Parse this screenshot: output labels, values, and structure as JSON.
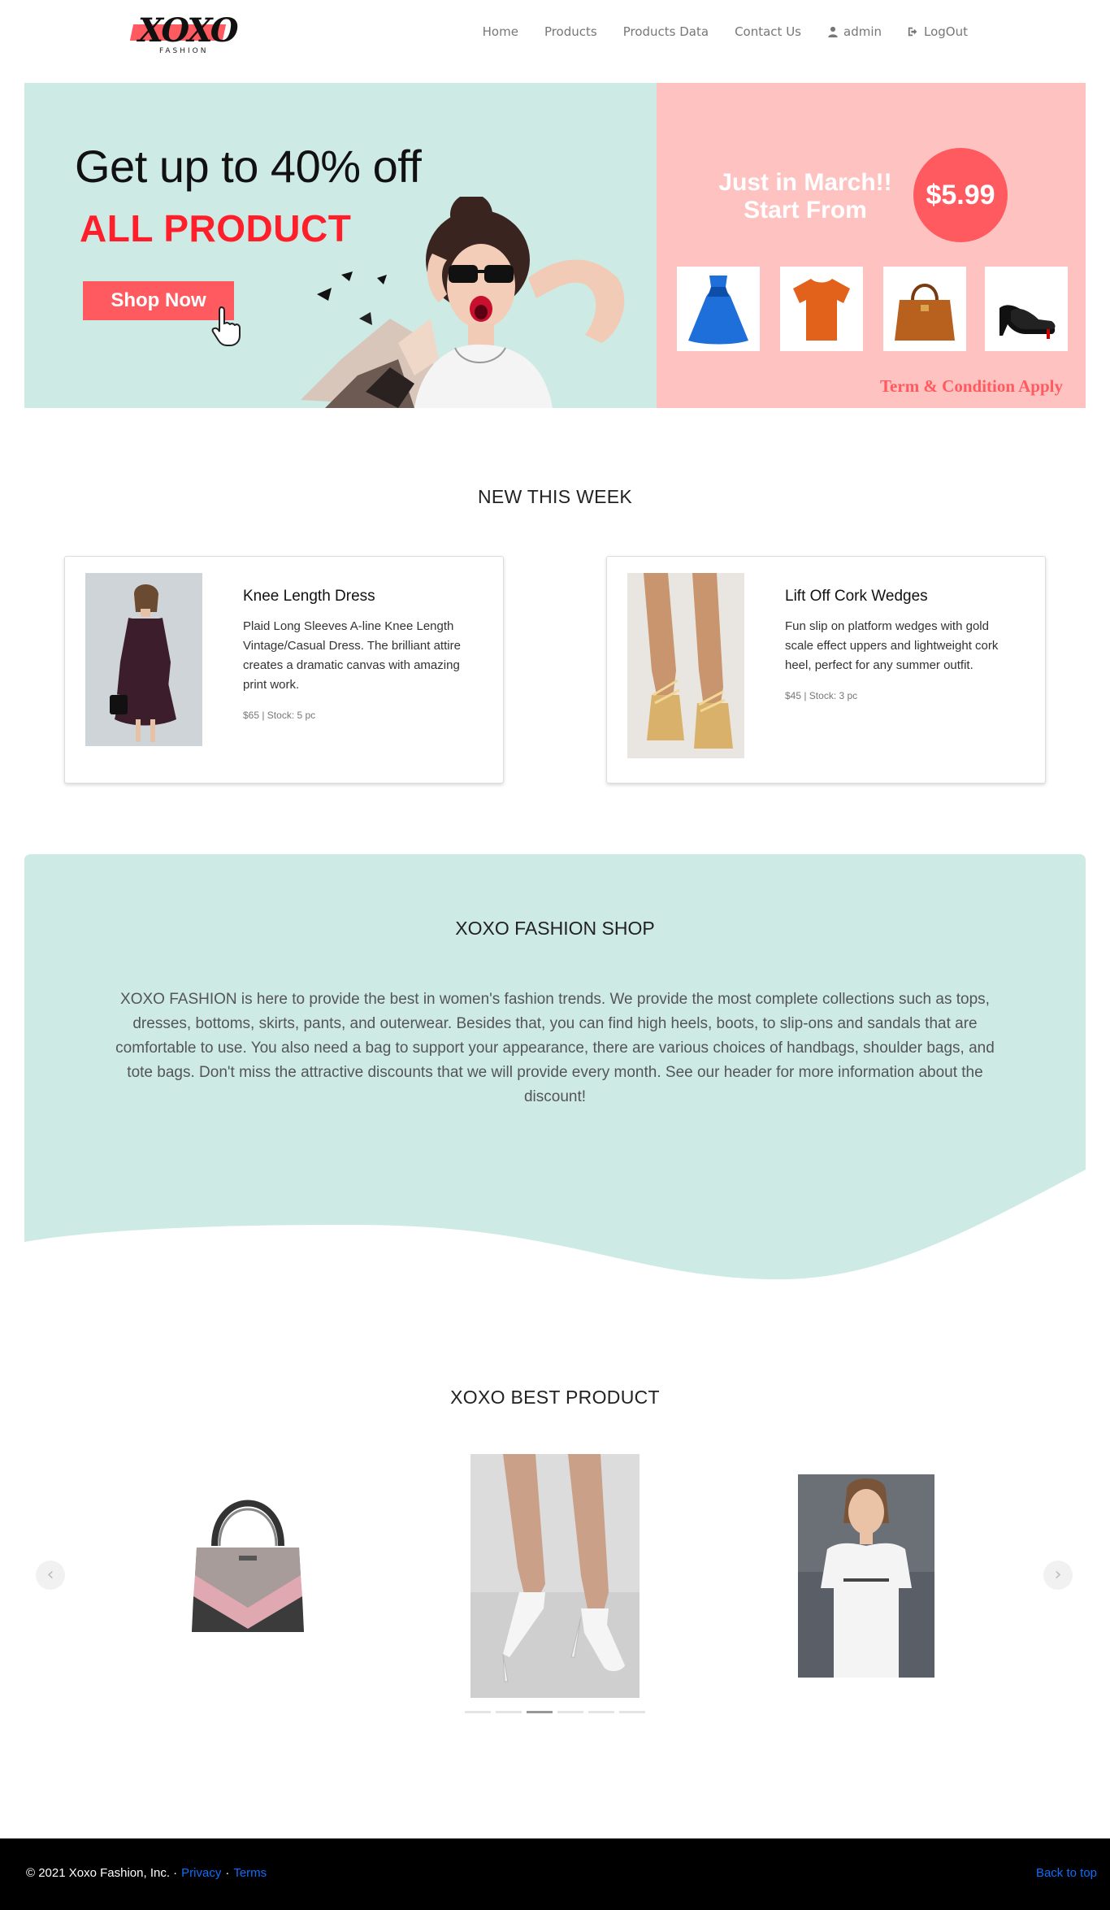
{
  "brand": {
    "logo_text": "XOXO",
    "logo_subtext": "FASHION"
  },
  "nav": {
    "items": [
      {
        "label": "Home"
      },
      {
        "label": "Products"
      },
      {
        "label": "Products Data"
      },
      {
        "label": "Contact Us"
      },
      {
        "label": "admin",
        "icon": "user-icon"
      },
      {
        "label": "LogOut",
        "icon": "sign-out-icon"
      }
    ]
  },
  "hero": {
    "headline": "Get up to 40% off",
    "subheadline": "ALL PRODUCT",
    "cta": "Shop Now",
    "promo_line1": "Just in March!!",
    "promo_line2": "Start From",
    "price": "$5.99",
    "terms": "Term & Condition Apply",
    "promo_items": [
      "dress-icon",
      "tshirt-icon",
      "handbag-icon",
      "high-heel-icon"
    ],
    "colors": {
      "left_bg": "#cdeae5",
      "right_bg": "#fec3c1",
      "accent": "#ff5a5f",
      "headline_red": "#ff1f2a"
    }
  },
  "new_this_week": {
    "title": "NEW THIS WEEK",
    "cards": [
      {
        "title": "Knee Length Dress",
        "text": "Plaid Long Sleeves A-line Knee Length Vintage/Casual Dress. The brilliant attire creates a dramatic canvas with amazing print work.",
        "meta": "$65 | Stock: 5 pc"
      },
      {
        "title": "Lift Off Cork Wedges",
        "text": "Fun slip on platform wedges with gold scale effect uppers and lightweight cork heel, perfect for any summer outfit.",
        "meta": "$45 | Stock: 3 pc"
      }
    ]
  },
  "about": {
    "title": "XOXO FASHION SHOP",
    "text": "XOXO FASHION is here to provide the best in women's fashion trends. We provide the most complete collections such as tops, dresses, bottoms, skirts, pants, and outerwear. Besides that, you can find high heels, boots, to slip-ons and sandals that are comfortable to use. You also need a bag to support your appearance, there are various choices of handbags, shoulder bags, and tote bags. Don't miss the attractive discounts that we will provide every month. See our header for more information about the discount!"
  },
  "best_product": {
    "title": "XOXO BEST PRODUCT",
    "prev_icon": "chevron-left-icon",
    "next_icon": "chevron-right-icon",
    "prev_glyph": "‹",
    "next_glyph": "›",
    "indicator_count": 6,
    "active_indicator": 3
  },
  "footer": {
    "copyright": "© 2021 Xoxo Fashion, Inc. ·",
    "privacy": "Privacy",
    "separator": "·",
    "terms": "Terms",
    "back_to_top": "Back to top"
  }
}
